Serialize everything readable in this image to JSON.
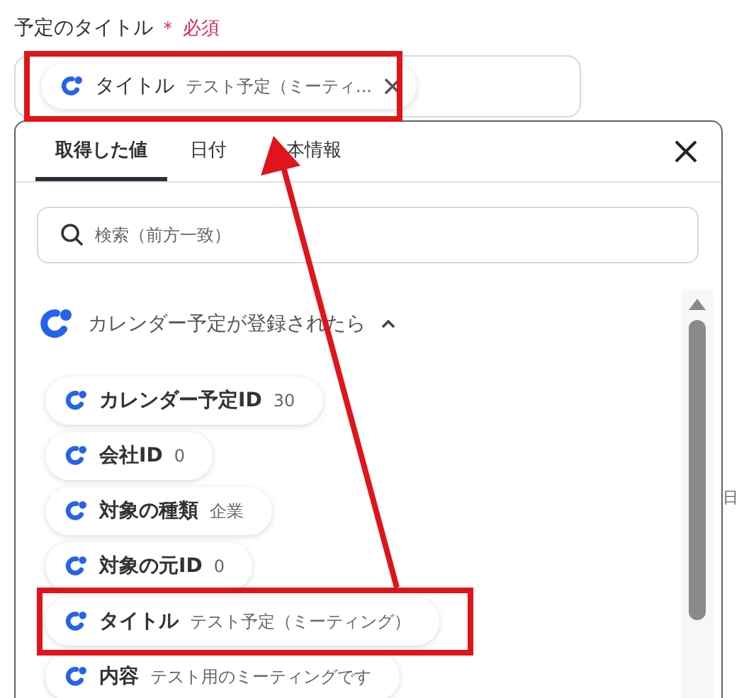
{
  "field": {
    "label": "予定のタイトル",
    "required_mark": "＊",
    "required_text": "必須",
    "token": {
      "label": "タイトル",
      "value": "テスト予定（ミーティ..."
    }
  },
  "picker": {
    "tabs": [
      {
        "label": "取得した値",
        "selected": true
      },
      {
        "label": "日付",
        "selected": false
      },
      {
        "label": "本情報",
        "selected": false
      }
    ],
    "search": {
      "placeholder": "検索（前方一致）"
    },
    "group": {
      "title": "カレンダー予定が登録されたら",
      "expanded": true,
      "items": [
        {
          "label": "カレンダー予定ID",
          "value": "30"
        },
        {
          "label": "会社ID",
          "value": "0"
        },
        {
          "label": "対象の種類",
          "value": "企業"
        },
        {
          "label": "対象の元ID",
          "value": "0"
        },
        {
          "label": "タイトル",
          "value": "テスト予定（ミーティング）"
        },
        {
          "label": "内容",
          "value": "テスト用のミーティングです"
        }
      ]
    }
  },
  "background": {
    "side_text": "日"
  }
}
